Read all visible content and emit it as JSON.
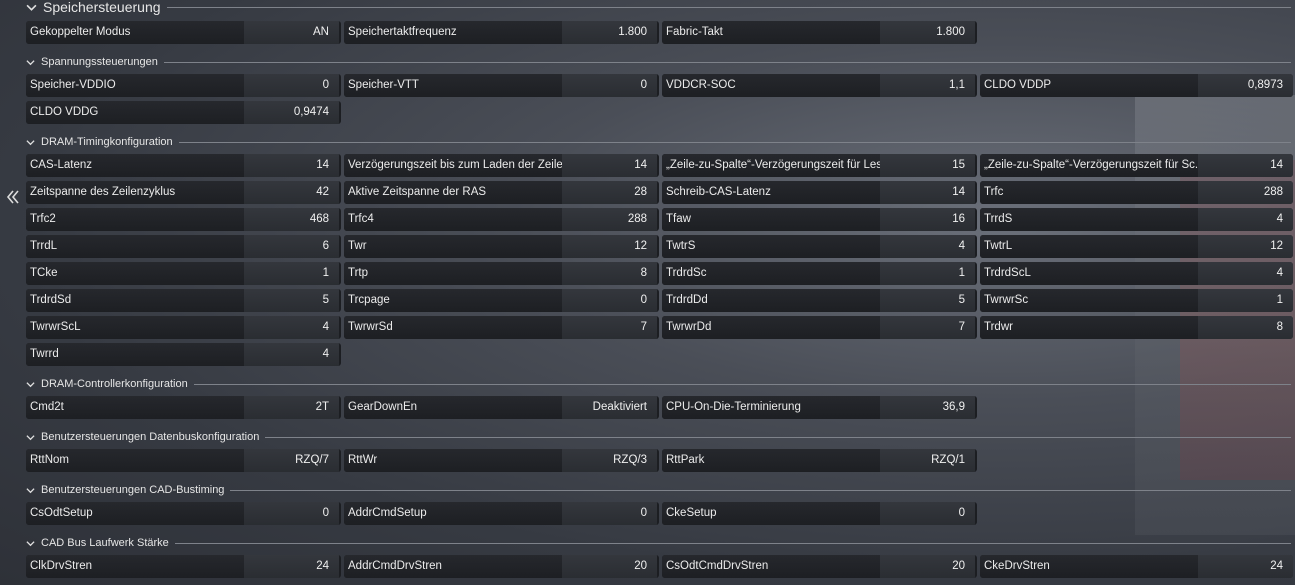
{
  "sections": {
    "memory_control": {
      "title": "Speichersteuerung"
    },
    "voltage": {
      "title": "Spannungssteuerungen"
    },
    "timing": {
      "title": "DRAM-Timingkonfiguration"
    },
    "controller": {
      "title": "DRAM-Controllerkonfiguration"
    },
    "databus": {
      "title": "Benutzersteuerungen Datenbuskonfiguration"
    },
    "cadbus": {
      "title": "Benutzersteuerungen CAD-Bustiming"
    },
    "drive": {
      "title": "CAD Bus Laufwerk Stärke"
    }
  },
  "rows": {
    "r0": [
      {
        "label": "Gekoppelter Modus",
        "value": "AN"
      },
      {
        "label": "Speichertaktfrequenz",
        "value": "1.800"
      },
      {
        "label": "Fabric-Takt",
        "value": "1.800"
      }
    ],
    "r1": [
      {
        "label": "Speicher-VDDIO",
        "value": "0"
      },
      {
        "label": "Speicher-VTT",
        "value": "0"
      },
      {
        "label": "VDDCR-SOC",
        "value": "1,1"
      },
      {
        "label": "CLDO VDDP",
        "value": "0,8973"
      }
    ],
    "r2": [
      {
        "label": "CLDO VDDG",
        "value": "0,9474"
      }
    ],
    "r3": [
      {
        "label": "CAS-Latenz",
        "value": "14"
      },
      {
        "label": "Verzögerungszeit bis zum Laden der Zeile",
        "value": "14"
      },
      {
        "label": "„Zeile-zu-Spalte“-Verzögerungszeit für Les...",
        "value": "15"
      },
      {
        "label": "„Zeile-zu-Spalte“-Verzögerungszeit für Sc...",
        "value": "14"
      }
    ],
    "r4": [
      {
        "label": "Zeitspanne des Zeilenzyklus",
        "value": "42"
      },
      {
        "label": "Aktive Zeitspanne der RAS",
        "value": "28"
      },
      {
        "label": "Schreib-CAS-Latenz",
        "value": "14"
      },
      {
        "label": "Trfc",
        "value": "288"
      }
    ],
    "r5": [
      {
        "label": "Trfc2",
        "value": "468"
      },
      {
        "label": "Trfc4",
        "value": "288"
      },
      {
        "label": "Tfaw",
        "value": "16"
      },
      {
        "label": "TrrdS",
        "value": "4"
      }
    ],
    "r6": [
      {
        "label": "TrrdL",
        "value": "6"
      },
      {
        "label": "Twr",
        "value": "12"
      },
      {
        "label": "TwtrS",
        "value": "4"
      },
      {
        "label": "TwtrL",
        "value": "12"
      }
    ],
    "r7": [
      {
        "label": "TCke",
        "value": "1"
      },
      {
        "label": "Trtp",
        "value": "8"
      },
      {
        "label": "TrdrdSc",
        "value": "1"
      },
      {
        "label": "TrdrdScL",
        "value": "4"
      }
    ],
    "r8": [
      {
        "label": "TrdrdSd",
        "value": "5"
      },
      {
        "label": "Trcpage",
        "value": "0"
      },
      {
        "label": "TrdrdDd",
        "value": "5"
      },
      {
        "label": "TwrwrSc",
        "value": "1"
      }
    ],
    "r9": [
      {
        "label": "TwrwrScL",
        "value": "4"
      },
      {
        "label": "TwrwrSd",
        "value": "7"
      },
      {
        "label": "TwrwrDd",
        "value": "7"
      },
      {
        "label": "Trdwr",
        "value": "8"
      }
    ],
    "r10": [
      {
        "label": "Twrrd",
        "value": "4"
      }
    ],
    "r11": [
      {
        "label": "Cmd2t",
        "value": "2T"
      },
      {
        "label": "GearDownEn",
        "value": "Deaktiviert"
      },
      {
        "label": "CPU-On-Die-Terminierung",
        "value": "36,9"
      }
    ],
    "r12": [
      {
        "label": "RttNom",
        "value": "RZQ/7"
      },
      {
        "label": "RttWr",
        "value": "RZQ/3"
      },
      {
        "label": "RttPark",
        "value": "RZQ/1"
      }
    ],
    "r13": [
      {
        "label": "CsOdtSetup",
        "value": "0"
      },
      {
        "label": "AddrCmdSetup",
        "value": "0"
      },
      {
        "label": "CkeSetup",
        "value": "0"
      }
    ],
    "r14": [
      {
        "label": "ClkDrvStren",
        "value": "24"
      },
      {
        "label": "AddrCmdDrvStren",
        "value": "20"
      },
      {
        "label": "CsOdtCmdDrvStren",
        "value": "20"
      },
      {
        "label": "CkeDrvStren",
        "value": "24"
      }
    ]
  },
  "icons": {
    "section_toggle": "chevron-down-icon",
    "sidebar_toggle": "double-chevron-left-icon"
  }
}
